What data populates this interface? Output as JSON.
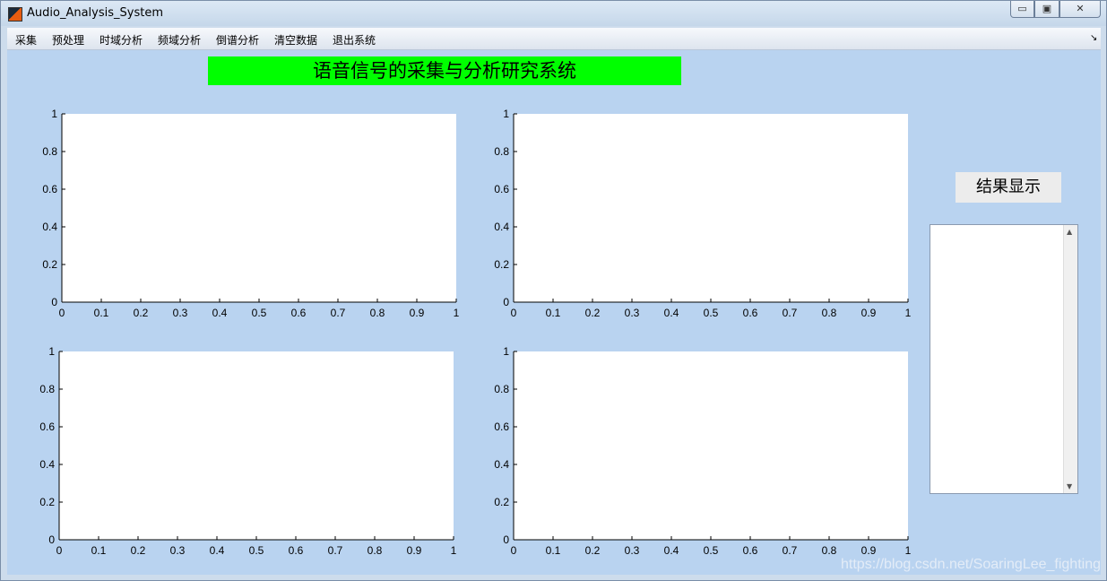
{
  "window": {
    "title": "Audio_Analysis_System",
    "controls": {
      "minimize": "▭",
      "maximize": "▣",
      "close": "✕"
    }
  },
  "menu": {
    "items": [
      "采集",
      "预处理",
      "时域分析",
      "频域分析",
      "倒谱分析",
      "清空数据",
      "退出系统"
    ],
    "overflow_icon": "↘"
  },
  "banner": {
    "text": "语音信号的采集与分析研究系统",
    "color": "#00ff00"
  },
  "result": {
    "label": "结果显示"
  },
  "watermark": "https://blog.csdn.net/SoaringLee_fighting",
  "chart_data": [
    {
      "type": "line",
      "series": [],
      "xlim": [
        0,
        1
      ],
      "ylim": [
        0,
        1
      ],
      "xticks": [
        "0",
        "0.1",
        "0.2",
        "0.3",
        "0.4",
        "0.5",
        "0.6",
        "0.7",
        "0.8",
        "0.9",
        "1"
      ],
      "yticks": [
        "0",
        "0.2",
        "0.4",
        "0.6",
        "0.8",
        "1"
      ],
      "grid": false
    },
    {
      "type": "line",
      "series": [],
      "xlim": [
        0,
        1
      ],
      "ylim": [
        0,
        1
      ],
      "xticks": [
        "0",
        "0.1",
        "0.2",
        "0.3",
        "0.4",
        "0.5",
        "0.6",
        "0.7",
        "0.8",
        "0.9",
        "1"
      ],
      "yticks": [
        "0",
        "0.2",
        "0.4",
        "0.6",
        "0.8",
        "1"
      ],
      "grid": false
    },
    {
      "type": "line",
      "series": [],
      "xlim": [
        0,
        1
      ],
      "ylim": [
        0,
        1
      ],
      "xticks": [
        "0",
        "0.1",
        "0.2",
        "0.3",
        "0.4",
        "0.5",
        "0.6",
        "0.7",
        "0.8",
        "0.9",
        "1"
      ],
      "yticks": [
        "0",
        "0.2",
        "0.4",
        "0.6",
        "0.8",
        "1"
      ],
      "grid": false
    },
    {
      "type": "line",
      "series": [],
      "xlim": [
        0,
        1
      ],
      "ylim": [
        0,
        1
      ],
      "xticks": [
        "0",
        "0.1",
        "0.2",
        "0.3",
        "0.4",
        "0.5",
        "0.6",
        "0.7",
        "0.8",
        "0.9",
        "1"
      ],
      "yticks": [
        "0",
        "0.2",
        "0.4",
        "0.6",
        "0.8",
        "1"
      ],
      "grid": false
    }
  ]
}
